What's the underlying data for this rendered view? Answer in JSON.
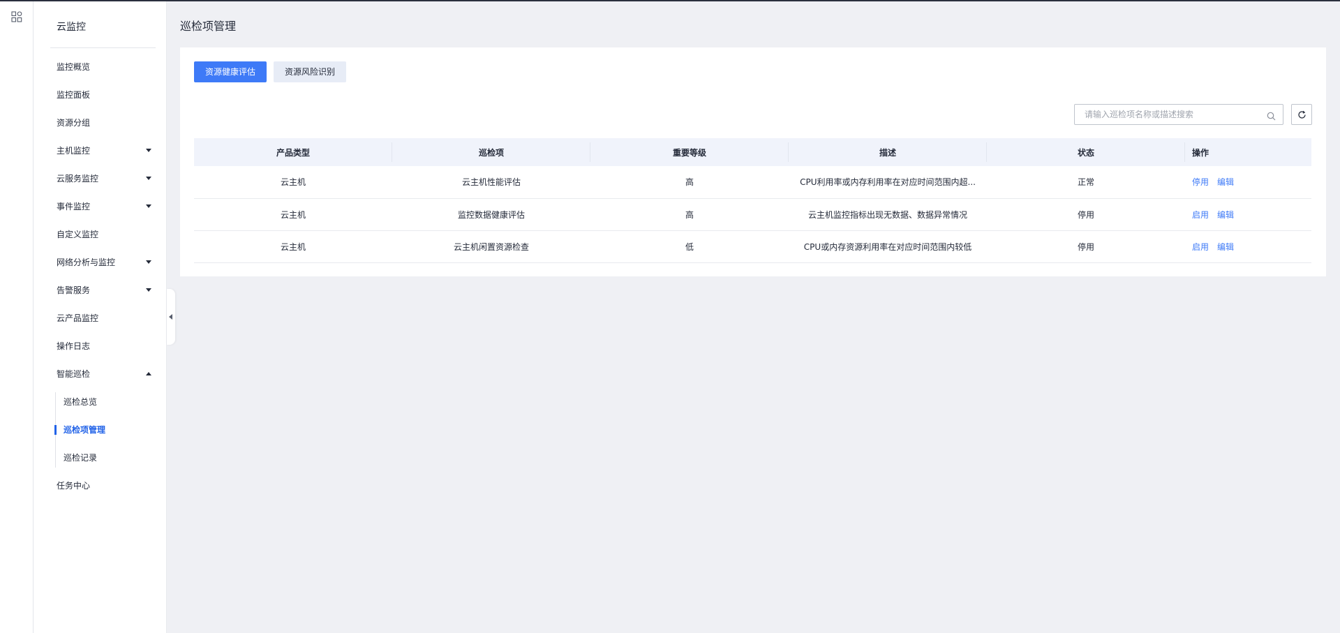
{
  "rail": {
    "apps_icon": "grid-apps-icon"
  },
  "sidebar": {
    "title": "云监控",
    "items": [
      {
        "label": "监控概览",
        "caret": ""
      },
      {
        "label": "监控面板",
        "caret": ""
      },
      {
        "label": "资源分组",
        "caret": ""
      },
      {
        "label": "主机监控",
        "caret": "down"
      },
      {
        "label": "云服务监控",
        "caret": "down"
      },
      {
        "label": "事件监控",
        "caret": "down"
      },
      {
        "label": "自定义监控",
        "caret": ""
      },
      {
        "label": "网络分析与监控",
        "caret": "down"
      },
      {
        "label": "告警服务",
        "caret": "down"
      },
      {
        "label": "云产品监控",
        "caret": ""
      },
      {
        "label": "操作日志",
        "caret": ""
      },
      {
        "label": "智能巡检",
        "caret": "up"
      }
    ],
    "subitems": [
      {
        "label": "巡检总览",
        "active": false
      },
      {
        "label": "巡检项管理",
        "active": true
      },
      {
        "label": "巡检记录",
        "active": false
      }
    ],
    "last_item": "任务中心"
  },
  "main": {
    "page_title": "巡检项管理",
    "tabs": [
      {
        "label": "资源健康评估",
        "active": true
      },
      {
        "label": "资源风险识别",
        "active": false
      }
    ],
    "search": {
      "placeholder": "请输入巡检项名称或描述搜索"
    },
    "table": {
      "headers": [
        "产品类型",
        "巡检项",
        "重要等级",
        "描述",
        "状态",
        "操作"
      ],
      "rows": [
        {
          "type": "云主机",
          "item": "云主机性能评估",
          "level": "高",
          "desc": "CPU利用率或内存利用率在对应时间范围内超...",
          "status": "正常",
          "action1": "停用",
          "action2": "编辑"
        },
        {
          "type": "云主机",
          "item": "监控数据健康评估",
          "level": "高",
          "desc": "云主机监控指标出现无数据、数据异常情况",
          "status": "停用",
          "action1": "启用",
          "action2": "编辑"
        },
        {
          "type": "云主机",
          "item": "云主机闲置资源检查",
          "level": "低",
          "desc": "CPU或内存资源利用率在对应时间范围内较低",
          "status": "停用",
          "action1": "启用",
          "action2": "编辑"
        }
      ]
    }
  },
  "colors": {
    "primary": "#3e7af7",
    "active_menu": "#2263e8",
    "background": "#eff0f4"
  }
}
